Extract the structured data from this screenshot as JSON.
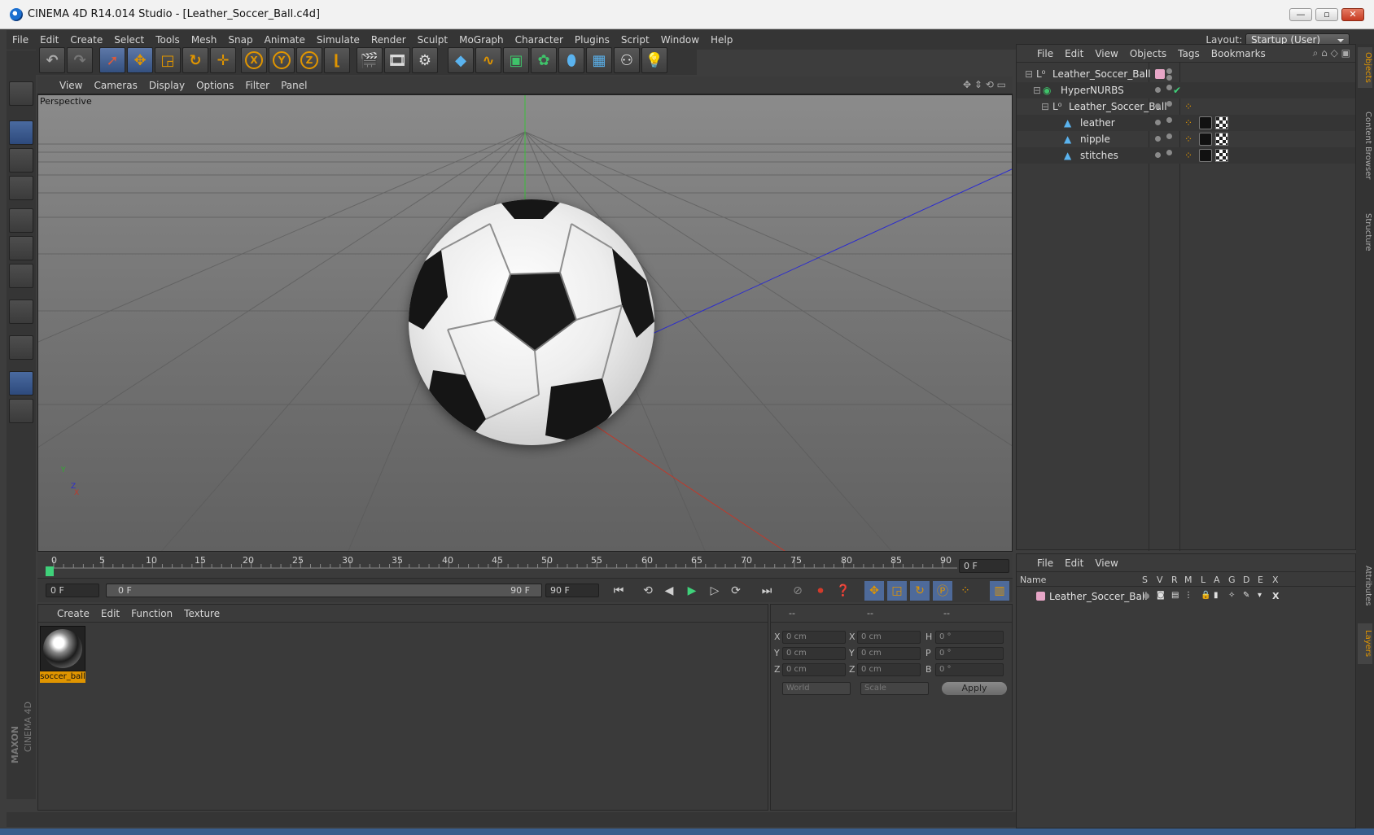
{
  "window": {
    "title": "CINEMA 4D R14.014 Studio - [Leather_Soccer_Ball.c4d]",
    "minimize": "—",
    "maximize": "▫",
    "close": "✕"
  },
  "menu": [
    "File",
    "Edit",
    "Create",
    "Select",
    "Tools",
    "Mesh",
    "Snap",
    "Animate",
    "Simulate",
    "Render",
    "Sculpt",
    "MoGraph",
    "Character",
    "Plugins",
    "Script",
    "Window",
    "Help"
  ],
  "layout": {
    "label": "Layout:",
    "value": "Startup (User)"
  },
  "toolbar": {
    "x": "X",
    "y": "Y",
    "z": "Z"
  },
  "viewport": {
    "menu": [
      "View",
      "Cameras",
      "Display",
      "Options",
      "Filter",
      "Panel"
    ],
    "label": "Perspective",
    "axis_y": "Y",
    "axis_z": "Z",
    "axis_x": "X"
  },
  "timeline": {
    "ticks": [
      "0",
      "5",
      "10",
      "15",
      "20",
      "25",
      "30",
      "35",
      "40",
      "45",
      "50",
      "55",
      "60",
      "65",
      "70",
      "75",
      "80",
      "85",
      "90"
    ],
    "current": "0 F"
  },
  "transport": {
    "start": "0 F",
    "slider_left": "0 F",
    "slider_right": "90 F",
    "end": "90 F"
  },
  "material_manager": {
    "menu": [
      "Create",
      "Edit",
      "Function",
      "Texture"
    ],
    "material": "soccer_ball"
  },
  "coords": {
    "head": [
      "--",
      "--",
      "--"
    ],
    "rows": [
      {
        "l1": "X",
        "v1": "0 cm",
        "l2": "X",
        "v2": "0 cm",
        "l3": "H",
        "v3": "0 °"
      },
      {
        "l1": "Y",
        "v1": "0 cm",
        "l2": "Y",
        "v2": "0 cm",
        "l3": "P",
        "v3": "0 °"
      },
      {
        "l1": "Z",
        "v1": "0 cm",
        "l2": "Z",
        "v2": "0 cm",
        "l3": "B",
        "v3": "0 °"
      }
    ],
    "mode1": "World",
    "mode2": "Scale",
    "apply": "Apply"
  },
  "object_manager": {
    "menu": [
      "File",
      "Edit",
      "View",
      "Objects",
      "Tags",
      "Bookmarks"
    ],
    "objects": [
      {
        "name": "Leather_Soccer_Ball"
      },
      {
        "name": "HyperNURBS"
      },
      {
        "name": "Leather_Soccer_Ball"
      },
      {
        "name": "leather"
      },
      {
        "name": "nipple"
      },
      {
        "name": "stitches"
      }
    ]
  },
  "layer_manager": {
    "menu": [
      "File",
      "Edit",
      "View"
    ],
    "columns": [
      "Name",
      "S",
      "V",
      "R",
      "M",
      "L",
      "A",
      "G",
      "D",
      "E",
      "X"
    ],
    "layer": "Leather_Soccer_Ball"
  },
  "side_tabs": [
    "Objects",
    "Content Browser",
    "Structure",
    "Attributes",
    "Layers"
  ],
  "branding": {
    "maxon": "MAXON",
    "product": "CINEMA 4D"
  },
  "colors": {
    "accent": "#e09500",
    "selection": "#3d5f99",
    "layer": "#e7a6c7"
  }
}
